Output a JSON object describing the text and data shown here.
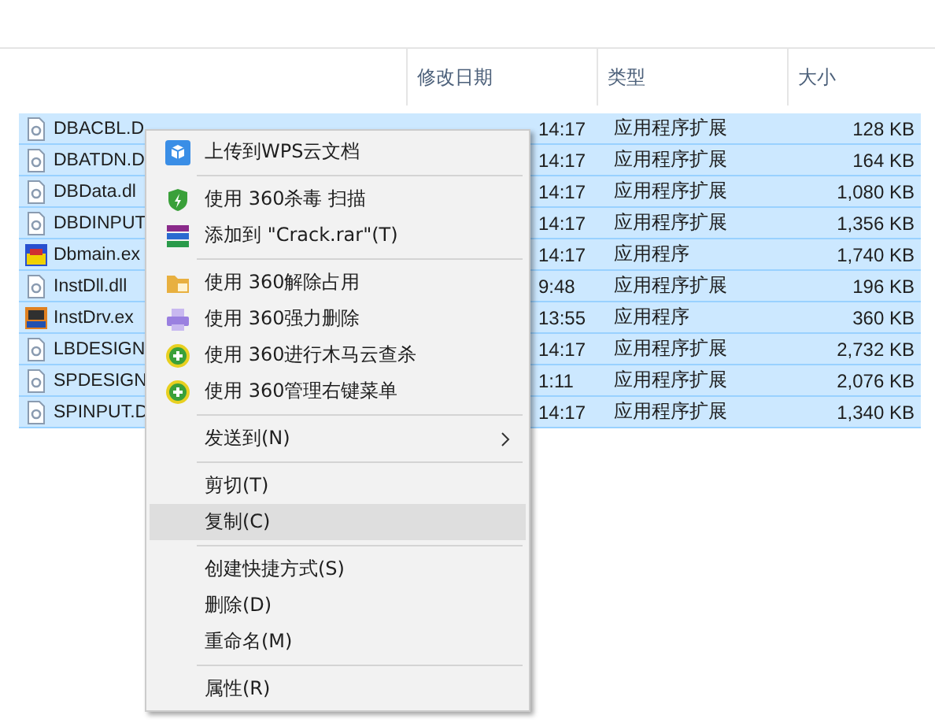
{
  "table": {
    "columns": [
      "修改日期",
      "类型",
      "大小"
    ],
    "rows": [
      {
        "name": "DBACBL.D",
        "date": "14:17",
        "type": "应用程序扩展",
        "size": "128 KB",
        "kind": "library",
        "selected": true
      },
      {
        "name": "DBATDN.D",
        "date": "14:17",
        "type": "应用程序扩展",
        "size": "164 KB",
        "kind": "library",
        "selected": true
      },
      {
        "name": "DBData.dl",
        "date": "14:17",
        "type": "应用程序扩展",
        "size": "1,080 KB",
        "kind": "library",
        "selected": true
      },
      {
        "name": "DBDINPUT",
        "date": "14:17",
        "type": "应用程序扩展",
        "size": "1,356 KB",
        "kind": "library",
        "selected": true
      },
      {
        "name": "Dbmain.ex",
        "date": "14:17",
        "type": "应用程序",
        "size": "1,740 KB",
        "kind": "program",
        "selected": true
      },
      {
        "name": "InstDll.dll",
        "date": "9:48",
        "type": "应用程序扩展",
        "size": "196 KB",
        "kind": "library",
        "selected": true
      },
      {
        "name": "InstDrv.ex",
        "date": "13:55",
        "type": "应用程序",
        "size": "360 KB",
        "kind": "installer",
        "selected": true
      },
      {
        "name": "LBDESIGN",
        "date": "14:17",
        "type": "应用程序扩展",
        "size": "2,732 KB",
        "kind": "library",
        "selected": true
      },
      {
        "name": "SPDESIGN",
        "date": "1:11",
        "type": "应用程序扩展",
        "size": "2,076 KB",
        "kind": "library",
        "selected": true
      },
      {
        "name": "SPINPUT.D",
        "date": "14:17",
        "type": "应用程序扩展",
        "size": "1,340 KB",
        "kind": "library",
        "selected": true
      }
    ]
  },
  "context_menu": {
    "items": [
      {
        "kind": "upload",
        "label": "上传到WPS云文档",
        "selected": false
      },
      {
        "kind": "separator"
      },
      {
        "kind": "antivirus",
        "label": "使用 360杀毒 扫描",
        "selected": false
      },
      {
        "kind": "archive",
        "label": "添加到 \"Crack.rar\"(T)",
        "selected": false
      },
      {
        "kind": "separator"
      },
      {
        "kind": "unlock",
        "label": "使用 360解除占用",
        "selected": false
      },
      {
        "kind": "shred",
        "label": "使用 360强力删除",
        "selected": false
      },
      {
        "kind": "guard",
        "label": "使用 360进行木马云查杀",
        "selected": false
      },
      {
        "kind": "guard",
        "label": "使用 360管理右键菜单",
        "selected": false
      },
      {
        "kind": "separator"
      },
      {
        "kind": "submenu",
        "label": "发送到(N)",
        "selected": false
      },
      {
        "kind": "separator"
      },
      {
        "kind": "item",
        "label": "剪切(T)",
        "selected": false
      },
      {
        "kind": "item",
        "label": "复制(C)",
        "selected": true
      },
      {
        "kind": "separator"
      },
      {
        "kind": "item",
        "label": "创建快捷方式(S)",
        "selected": false
      },
      {
        "kind": "item",
        "label": "删除(D)",
        "selected": false
      },
      {
        "kind": "item",
        "label": "重命名(M)",
        "selected": false
      },
      {
        "kind": "separator"
      },
      {
        "kind": "item",
        "label": "属性(R)",
        "selected": false
      }
    ]
  }
}
